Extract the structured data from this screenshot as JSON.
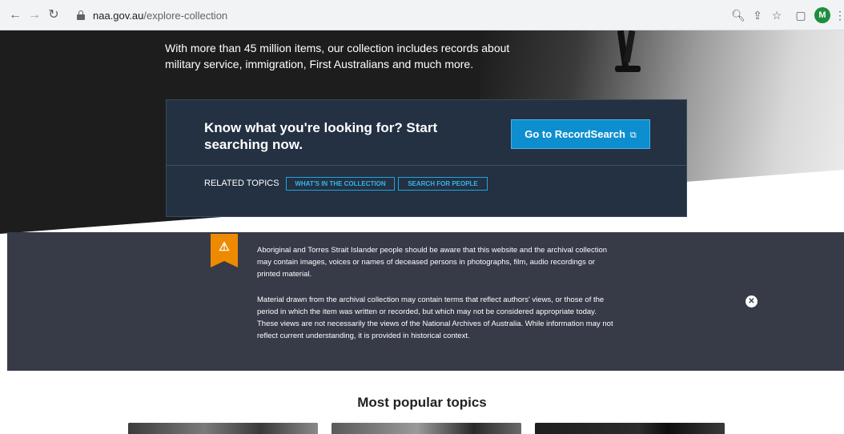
{
  "browser": {
    "url_host": "naa.gov.au",
    "url_path": "/explore-collection",
    "avatar_initial": "M"
  },
  "hero": {
    "text": "With more than 45 million items, our collection includes records about military service, immigration, First Australians and much more."
  },
  "search_card": {
    "heading": "Know what you're looking for? Start searching now.",
    "button_label": "Go to RecordSearch",
    "related_label": "RELATED TOPICS",
    "tags": [
      "WHAT'S IN THE COLLECTION",
      "SEARCH FOR PEOPLE"
    ]
  },
  "warning": {
    "paragraph_1": "Aboriginal and Torres Strait Islander people should be aware that this website and the archival collection may contain images, voices or names of deceased persons in photographs, film, audio recordings or printed material.",
    "paragraph_2": "Material drawn from the archival collection may contain terms that reflect authors' views, or those of the period in which the item was written or recorded, but which may not be considered appropriate today. These views are not necessarily the views of the National Archives of Australia. While information may not reflect current understanding, it is provided in historical context.",
    "accent_color": "#ee8a00"
  },
  "popular": {
    "title": "Most popular topics"
  }
}
